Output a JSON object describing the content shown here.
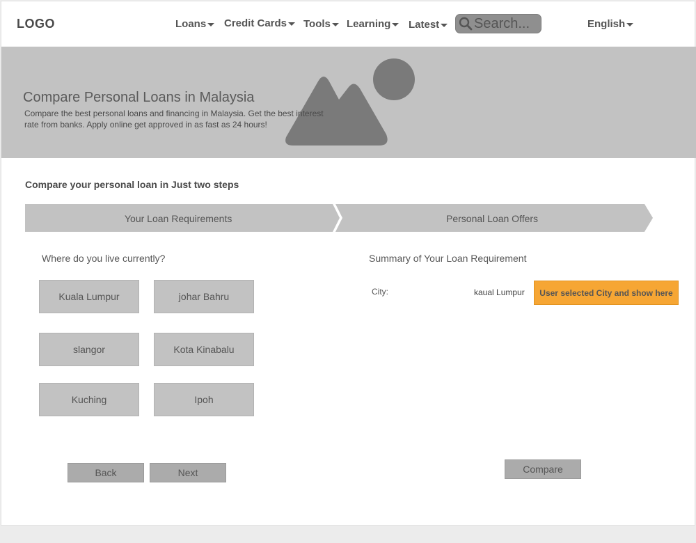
{
  "header": {
    "logo": "LOGO",
    "nav": [
      {
        "label": "Loans"
      },
      {
        "label": "Credit Cards"
      },
      {
        "label": "Tools"
      },
      {
        "label": "Learning"
      },
      {
        "label": "Latest"
      }
    ],
    "search_placeholder": "Search...",
    "language": "English"
  },
  "hero": {
    "title": "Compare Personal Loans in Malaysia",
    "description": "Compare the best personal loans and financing in Malaysia. Get the best interest rate from banks. Apply online get approved in as fast as 24 hours!"
  },
  "steps": {
    "title": "Compare your personal loan in Just two steps",
    "items": [
      "Your Loan Requirements",
      "Personal Loan Offers"
    ]
  },
  "location": {
    "question": "Where do you live currently?",
    "cities": [
      "Kuala Lumpur",
      "johar Bahru",
      "slangor",
      "Kota Kinabalu",
      "Kuching",
      "Ipoh"
    ]
  },
  "summary": {
    "heading": "Summary of Your Loan Requirement",
    "city_label": "City:",
    "city_value": "kaual Lumpur",
    "note": "User selected City and show here"
  },
  "actions": {
    "back": "Back",
    "next": "Next",
    "compare": "Compare"
  },
  "colors": {
    "highlight": "#f6a634",
    "hero_bg": "#c2c2c2",
    "button_bg": "#ababab"
  }
}
